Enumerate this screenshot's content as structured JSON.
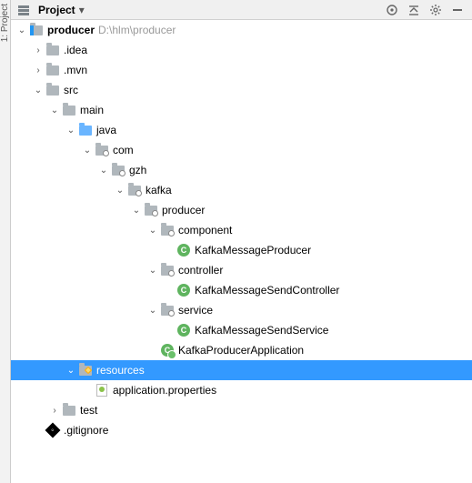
{
  "header": {
    "title": "Project"
  },
  "module": {
    "name": "producer",
    "path": "D:\\hlm\\producer"
  },
  "tree": {
    "idea": ".idea",
    "mvn": ".mvn",
    "src": "src",
    "main": "main",
    "java": "java",
    "com": "com",
    "gzh": "gzh",
    "kafka": "kafka",
    "producer": "producer",
    "component": "component",
    "component_class": "KafkaMessageProducer",
    "controller": "controller",
    "controller_class": "KafkaMessageSendController",
    "service": "service",
    "service_class": "KafkaMessageSendService",
    "app_class": "KafkaProducerApplication",
    "resources": "resources",
    "app_props": "application.properties",
    "test": "test",
    "gitignore": ".gitignore"
  }
}
